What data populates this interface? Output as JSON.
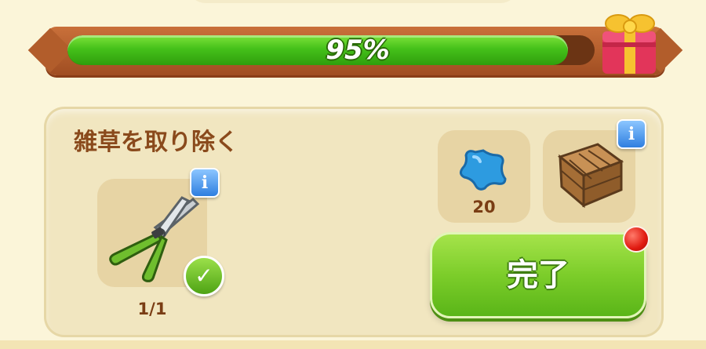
{
  "progress": {
    "value": 0.95,
    "label": "95%"
  },
  "task": {
    "title": "雑草を取り除く",
    "tool": {
      "icon": "pruning-shears-icon",
      "count": "1/1",
      "completed": true
    },
    "rewards": [
      {
        "icon": "blue-star-icon",
        "amount": "20"
      },
      {
        "icon": "wooden-crate-icon"
      }
    ],
    "complete_button": "完了"
  },
  "colors": {
    "accent_green": "#7ccd2a",
    "frame_brown": "#b25d2b",
    "title_brown": "#8a4a1c"
  }
}
